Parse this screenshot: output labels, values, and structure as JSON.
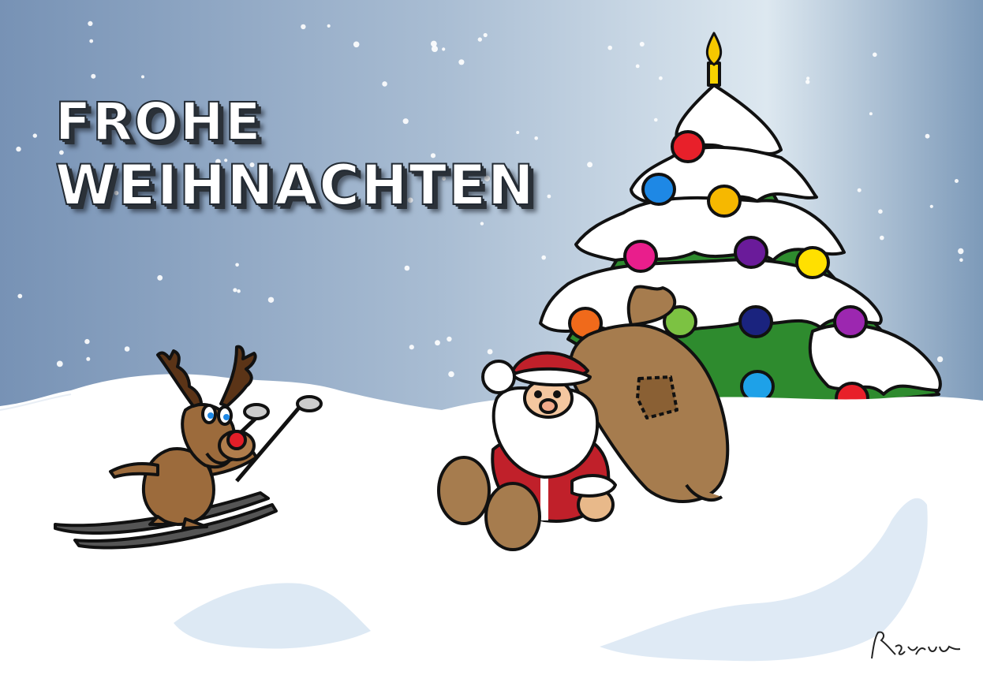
{
  "greeting": {
    "line1": "FROHE",
    "line2": "WEIHNACHTEN"
  },
  "signature": "RRoxum",
  "colors": {
    "sky_top": "#6f8db1",
    "sky_light": "#dbe6ef",
    "snow": "#ffffff",
    "snow_shadow": "#d4e3f1",
    "tree_green": "#2e8b2e",
    "santa_red": "#c0202a",
    "sack_brown": "#a67c4e",
    "reindeer_brown": "#9c6b3c"
  },
  "ornament_colors": [
    "#e8202a",
    "#1e88e5",
    "#f6b800",
    "#e91e8c",
    "#6a1b9a",
    "#ffe000",
    "#f06a1b",
    "#7cc242",
    "#1a237e",
    "#9c27b0",
    "#1ea1e8"
  ]
}
